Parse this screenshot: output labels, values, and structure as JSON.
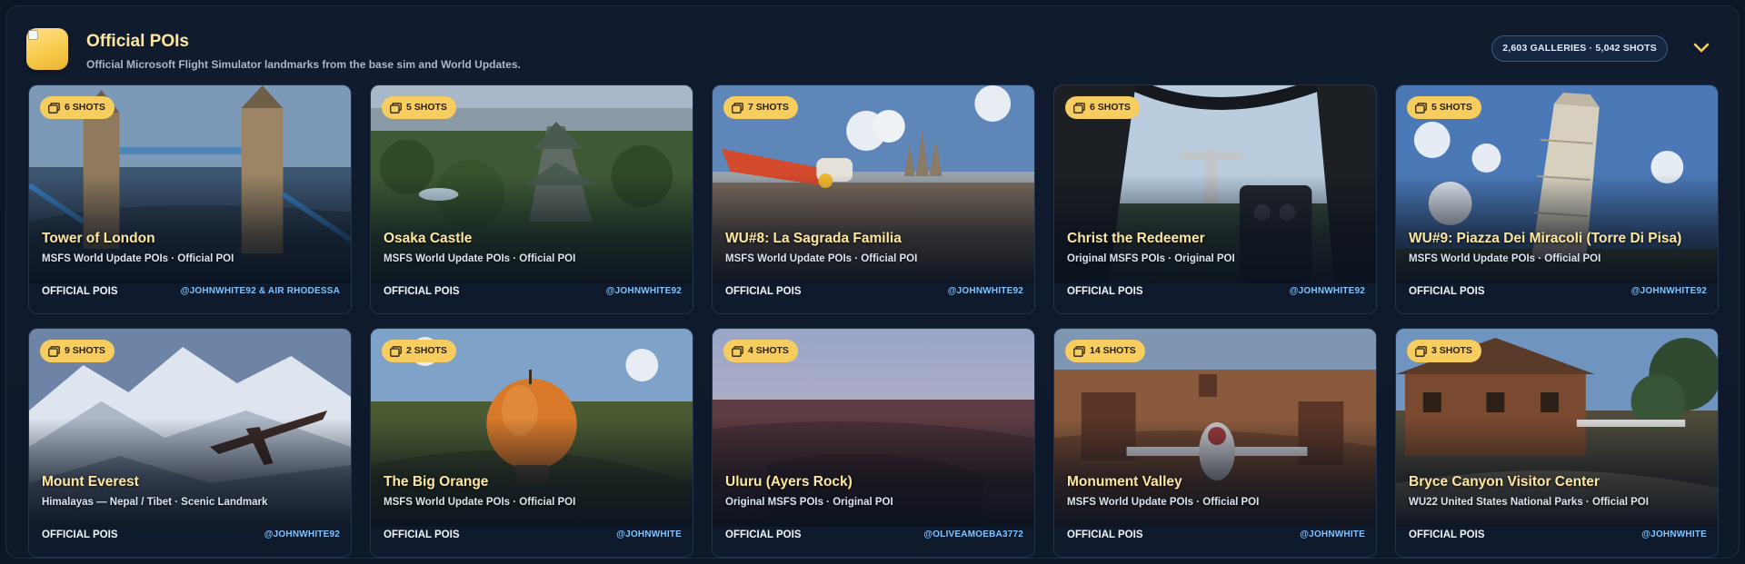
{
  "header": {
    "title": "Official POIs",
    "subtitle": "Official Microsoft Flight Simulator landmarks from the base sim and World Updates.",
    "stats": "2,603 GALLERIES · 5,042 SHOTS",
    "collapse_icon": "chevron-down-icon"
  },
  "colors": {
    "accent": "#f6cd5e",
    "title": "#fde7a0",
    "author": "#7fc2ff",
    "background": "#0c1626"
  },
  "cards": [
    {
      "shots": "6 SHOTS",
      "title": "Tower of London",
      "subtitle": "MSFS World Update POIs · Official POI",
      "category": "OFFICIAL POIS",
      "author": "@JOHNWHITE92 & AIR RHODESSA"
    },
    {
      "shots": "5 SHOTS",
      "title": "Osaka Castle",
      "subtitle": "MSFS World Update POIs · Official POI",
      "category": "OFFICIAL POIS",
      "author": "@JOHNWHITE92"
    },
    {
      "shots": "7 SHOTS",
      "title": "WU#8: La Sagrada Familia",
      "subtitle": "MSFS World Update POIs · Official POI",
      "category": "OFFICIAL POIS",
      "author": "@JOHNWHITE92"
    },
    {
      "shots": "6 SHOTS",
      "title": "Christ the Redeemer",
      "subtitle": "Original MSFS POIs · Original POI",
      "category": "OFFICIAL POIS",
      "author": "@JOHNWHITE92"
    },
    {
      "shots": "5 SHOTS",
      "title": "WU#9: Piazza Dei Miracoli (Torre Di Pisa)",
      "subtitle": "MSFS World Update POIs · Official POI",
      "category": "OFFICIAL POIS",
      "author": "@JOHNWHITE92"
    },
    {
      "shots": "9 SHOTS",
      "title": "Mount Everest",
      "subtitle": "Himalayas — Nepal / Tibet · Scenic Landmark",
      "category": "OFFICIAL POIS",
      "author": "@JOHNWHITE92"
    },
    {
      "shots": "2 SHOTS",
      "title": "The Big Orange",
      "subtitle": "MSFS World Update POIs · Official POI",
      "category": "OFFICIAL POIS",
      "author": "@JOHNWHITE"
    },
    {
      "shots": "4 SHOTS",
      "title": "Uluru (Ayers Rock)",
      "subtitle": "Original MSFS POIs · Original POI",
      "category": "OFFICIAL POIS",
      "author": "@OLIVEAMOEBA3772"
    },
    {
      "shots": "14 SHOTS",
      "title": "Monument Valley",
      "subtitle": "MSFS World Update POIs · Official POI",
      "category": "OFFICIAL POIS",
      "author": "@JOHNWHITE"
    },
    {
      "shots": "3 SHOTS",
      "title": "Bryce Canyon Visitor Center",
      "subtitle": "WU22 United States National Parks · Official POI",
      "category": "OFFICIAL POIS",
      "author": "@JOHNWHITE"
    }
  ]
}
